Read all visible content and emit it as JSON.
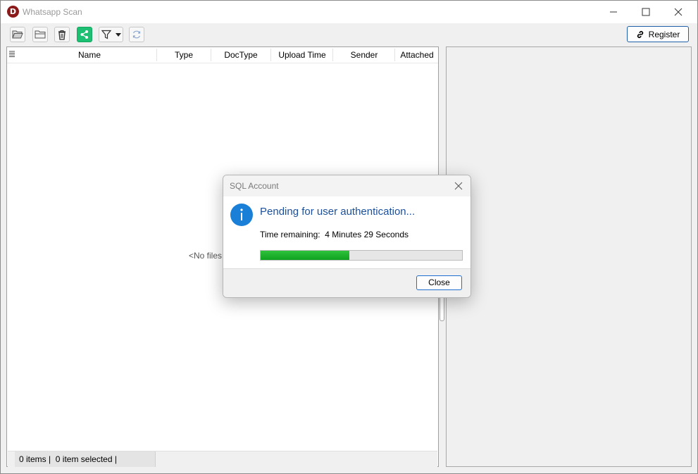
{
  "window": {
    "title": "Whatsapp Scan",
    "app_icon_letter": "D"
  },
  "toolbar": {
    "register_label": "Register"
  },
  "table": {
    "columns": [
      "Name",
      "Type",
      "DocType",
      "Upload Time",
      "Sender",
      "Attached"
    ],
    "empty_text": "<No files"
  },
  "statusbar": {
    "text": "0 items |  0 item selected |"
  },
  "dialog": {
    "title": "SQL Account",
    "heading": "Pending for user authentication...",
    "time_label": "Time remaining:",
    "time_value": "4 Minutes 29 Seconds",
    "progress_fraction": 0.44,
    "close_label": "Close"
  },
  "colors": {
    "accent": "#1a7fd6",
    "heading": "#1b4f9c",
    "progress": "#18b02c",
    "share": "#1dbf73",
    "app_icon": "#8b1a1a"
  },
  "icons": {
    "toolbar": [
      "open-folder-icon",
      "folder-icon",
      "trash-icon",
      "share-icon",
      "filter-icon",
      "refresh-icon"
    ],
    "register": "link-icon",
    "dialog": "info-icon"
  }
}
